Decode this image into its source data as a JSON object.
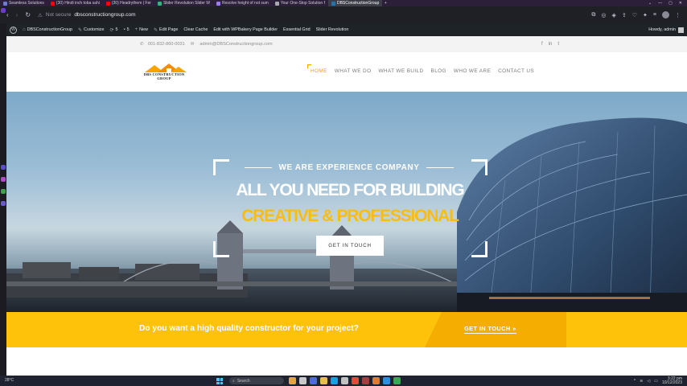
{
  "browser": {
    "tabs": [
      {
        "label": "Seamless Solutions",
        "color": "#6b7bd6"
      },
      {
        "label": "(30) Hindi inch toba sahi",
        "color": "#ff0000"
      },
      {
        "label": "(30) Headrythem | Fer",
        "color": "#ff0000"
      },
      {
        "label": "Slider Revolution Slider W",
        "color": "#36b37e"
      },
      {
        "label": "Resolve height of not sum",
        "color": "#9c7cf4"
      },
      {
        "label": "Your One-Stop Solution f",
        "color": "#aaaaaa"
      },
      {
        "label": "DBSConstructionGroup",
        "color": "#2271b1",
        "active": true
      }
    ],
    "new_tab": "+",
    "window_controls": [
      "⌄",
      "—",
      "▢",
      "✕"
    ],
    "security_label": "Not secure",
    "url": "dbsconstructiongroup.com"
  },
  "wp_admin_bar": {
    "site_name": "DBSConstructionGroup",
    "customize": "Customize",
    "updates_count": "5",
    "comments_count": "5",
    "new": "New",
    "edit_page": "Edit Page",
    "clear_cache": "Clear Cache",
    "edit_wpbakery": "Edit with WPBakery Page Builder",
    "essential_grid": "Essential Grid",
    "slider_revolution": "Slider Revolution",
    "howdy": "Howdy, admin"
  },
  "site": {
    "phone": "001-832-860-0031",
    "email": "admin@DBSConstructiongroup.com",
    "social": [
      "f",
      "in",
      "t"
    ],
    "logo_text": "DBS CONSTRUCTION GROUP",
    "nav": [
      "HOME",
      "WHAT WE DO",
      "WHAT WE BUILD",
      "BLOG",
      "WHO WE ARE",
      "CONTACT US"
    ],
    "nav_active": "HOME",
    "hero": {
      "eyebrow": "WE ARE EXPERIENCE COMPANY",
      "headline": "ALL YOU NEED FOR BUILDING",
      "subheadline": "CREATIVE & PROFESSIONAL",
      "cta": "GET IN TOUCH"
    },
    "strip": {
      "question": "Do you want a high quality constructor for your project?",
      "cta": "GET IN TOUCH  »"
    },
    "colors": {
      "accent": "#fdc209",
      "accent_dark": "#f4ad00",
      "nav_active": "#f7a400"
    }
  },
  "taskbar": {
    "weather": "28°C",
    "search_placeholder": "Search",
    "time": "3:22 pm",
    "date": "10/12/2023"
  }
}
